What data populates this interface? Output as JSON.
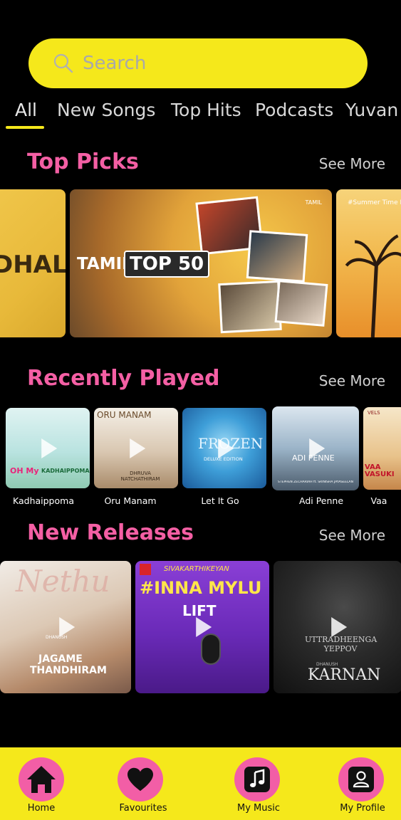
{
  "search": {
    "placeholder": "Search"
  },
  "tabs": [
    {
      "label": "All"
    },
    {
      "label": "New Songs"
    },
    {
      "label": "Top Hits"
    },
    {
      "label": "Podcasts"
    },
    {
      "label": "Yuvan"
    }
  ],
  "sections": {
    "top_picks": {
      "title": "Top Picks",
      "see_more": "See More",
      "cards": [
        {
          "text": "DHAL"
        },
        {
          "text_a": "TAMIL",
          "text_b": "TOP 50",
          "brand": "TAMIL"
        },
        {
          "text": "#Summer Time H"
        }
      ]
    },
    "recently_played": {
      "title": "Recently Played",
      "see_more": "See More",
      "items": [
        {
          "caption": "Kadhaippoma",
          "art_a": "OH My",
          "art_b": "KADHAIPPOMA"
        },
        {
          "caption": "Oru Manam",
          "art_a": "ORU MANAM",
          "art_b": "DHRUVA NATCHATHIRAM"
        },
        {
          "caption": "Let It Go",
          "art_a": "FROZEN",
          "art_b": "DELUXE EDITION"
        },
        {
          "caption": "Adi Penne",
          "art_a": "ADI PENNE",
          "art_b": "STEPHEN ZECHARIAH ft. SRINISHA JAYASEELAN"
        },
        {
          "caption": "Vaa",
          "art_a": "VAA VASUKI",
          "art_b": "VELS"
        }
      ]
    },
    "new_releases": {
      "title": "New Releases",
      "see_more": "See More",
      "items": [
        {
          "art_a": "JAGAME",
          "art_b": "THANDHIRAM",
          "art_c": "Nethu",
          "art_d": "DHANUSH"
        },
        {
          "art_a": "SIVAKARTHIKEYAN",
          "art_b": "#INNA MYLU",
          "art_c": "LIFT"
        },
        {
          "art_a": "UTTRADHEENGA YEPPOV",
          "art_b": "KARNAN",
          "art_c": "DHANUSH"
        }
      ]
    }
  },
  "bottom_nav": [
    {
      "label": "Home",
      "icon": "home-icon"
    },
    {
      "label": "Favourites",
      "icon": "heart-icon"
    },
    {
      "label": "My Music",
      "icon": "music-note-icon"
    },
    {
      "label": "My Profile",
      "icon": "person-icon"
    }
  ],
  "colors": {
    "background": "#000000",
    "accent_yellow": "#f5e81b",
    "accent_pink": "#f45fa4"
  }
}
